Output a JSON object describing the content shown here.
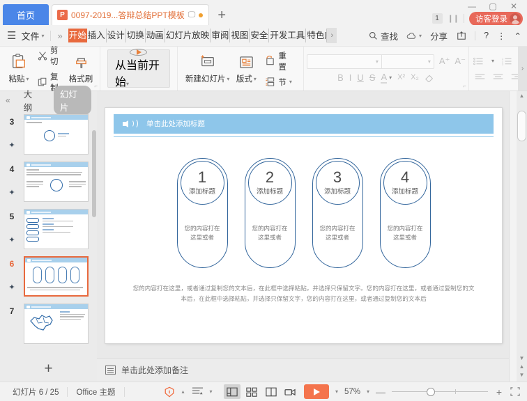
{
  "titlebar": {
    "home_tab": "首页",
    "doc_tab": {
      "icon": "ppt-file-icon",
      "icon_letter": "P",
      "name": "0097-2019...答辩总结PPT模板"
    },
    "new_tab": "+",
    "window": {
      "minimize": "—",
      "maximize": "▢",
      "close": "✕"
    },
    "count_badge": "1",
    "login_label": "访客登录"
  },
  "menubar": {
    "hamburger": "menu-icon",
    "file": "文件",
    "overflow": "»",
    "tabs": [
      {
        "label": "开始",
        "active": true
      },
      {
        "label": "插入",
        "active": false
      },
      {
        "label": "设计",
        "active": false
      },
      {
        "label": "切换",
        "active": false
      },
      {
        "label": "动画",
        "active": false
      },
      {
        "label": "幻灯片放映",
        "active": false
      },
      {
        "label": "审阅",
        "active": false
      },
      {
        "label": "视图",
        "active": false
      },
      {
        "label": "安全",
        "active": false
      },
      {
        "label": "开发工具",
        "active": false
      },
      {
        "label": "特色应用",
        "active": false
      }
    ],
    "scroll_next": "›",
    "right": {
      "find": "查找",
      "share": "分享",
      "help": "?",
      "more": "⋮",
      "collapse": "⌃"
    }
  },
  "ribbon": {
    "clipboard": {
      "paste": "粘贴",
      "cut": "剪切",
      "copy": "复制",
      "format_painter": "格式刷"
    },
    "present": {
      "start_from_current": "从当前开始"
    },
    "slides": {
      "new_slide": "新建幻灯片",
      "layout": "版式",
      "reset": "重置",
      "section": "节"
    },
    "font": {
      "font_name_value": "",
      "font_size_value": "",
      "grow": "A",
      "shrink": "A",
      "bold": "B",
      "italic": "I",
      "underline": "U",
      "strike": "S",
      "font_color": "A",
      "superscript": "X²",
      "subscript": "X₂",
      "clear_format": "clear-format-icon"
    },
    "paragraph": {
      "bullets": "bullet-list-icon",
      "numbering": "numbered-list-icon",
      "align_left": "align-left-icon",
      "align_center": "align-center-icon",
      "align_right": "align-right-icon"
    },
    "expand": "›"
  },
  "thumbnails": {
    "collapse": "«",
    "tab_outline": "大纲",
    "tab_slides": "幻灯片",
    "active_tab": "幻灯片",
    "items": [
      {
        "number": "3",
        "selected": false,
        "starred": true
      },
      {
        "number": "4",
        "selected": false,
        "starred": true
      },
      {
        "number": "5",
        "selected": false,
        "starred": true
      },
      {
        "number": "6",
        "selected": true,
        "starred": true
      },
      {
        "number": "7",
        "selected": false,
        "starred": false
      }
    ],
    "add_slide": "+"
  },
  "slide": {
    "title_placeholder": "单击此处添加标题",
    "header_icon": "speaker-icon",
    "pills": [
      {
        "number": "1",
        "title": "添加标题",
        "desc": "您的内容打在\n这里或者"
      },
      {
        "number": "2",
        "title": "添加标题",
        "desc": "您的内容打在\n这里或者"
      },
      {
        "number": "3",
        "title": "添加标题",
        "desc": "您的内容打在\n这里或者"
      },
      {
        "number": "4",
        "title": "添加标题",
        "desc": "您的内容打在\n这里或者"
      }
    ],
    "footer_paragraph": "您的内容打在这里，或者通过复制您的文本后，在此框中选择粘贴，并选择只保留文字。您的内容打在这里，或者通过复制您的文本后，在此框中选择粘贴，并选择只保留文字，您的内容打在这里，或者通过复制您的文本后"
  },
  "notes": {
    "placeholder": "单击此处添加备注",
    "icon": "notes-icon"
  },
  "statusbar": {
    "slide_counter": "幻灯片 6 / 25",
    "theme": "Office 主题",
    "spell_icon": "proofing-icon",
    "language_icon": "language-icon",
    "views": [
      {
        "name": "normal-view",
        "active": true
      },
      {
        "name": "slide-sorter-view",
        "active": false
      },
      {
        "name": "reading-view",
        "active": false
      },
      {
        "name": "presenter-view",
        "active": false
      }
    ],
    "play_button": "play-icon",
    "zoom_level": "57%",
    "zoom_out": "—",
    "zoom_in": "+",
    "fit_window": "fit-to-window-icon"
  },
  "colors": {
    "accent_orange": "#e8693d",
    "home_blue": "#4a86e8",
    "slide_blue": "#8ec6ea",
    "pill_blue": "#33669c",
    "login_red": "#e8695a",
    "play_orange": "#f4744d"
  }
}
